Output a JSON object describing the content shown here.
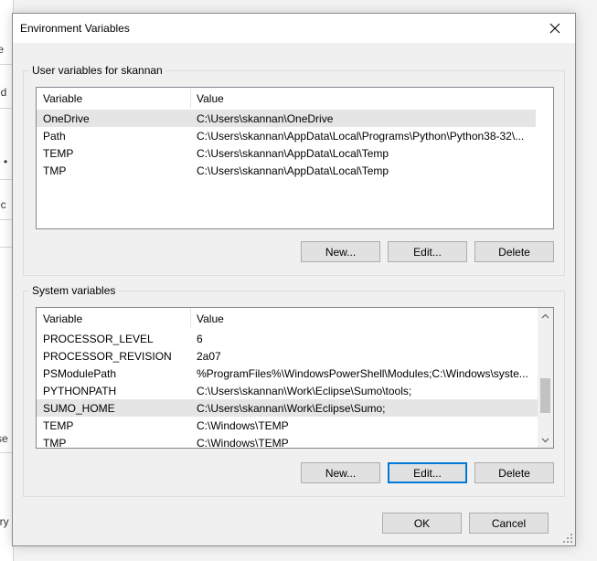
{
  "background_window": {
    "fragments": [
      "te",
      "ed",
      "•",
      "ec",
      "se",
      "ory"
    ]
  },
  "dialog": {
    "title": "Environment Variables",
    "close_icon": "close-icon"
  },
  "user_vars": {
    "group_label": "User variables for skannan",
    "columns": [
      "Variable",
      "Value"
    ],
    "rows": [
      {
        "name": "OneDrive",
        "value": "C:\\Users\\skannan\\OneDrive",
        "selected": true
      },
      {
        "name": "Path",
        "value": "C:\\Users\\skannan\\AppData\\Local\\Programs\\Python\\Python38-32\\...",
        "selected": false
      },
      {
        "name": "TEMP",
        "value": "C:\\Users\\skannan\\AppData\\Local\\Temp",
        "selected": false
      },
      {
        "name": "TMP",
        "value": "C:\\Users\\skannan\\AppData\\Local\\Temp",
        "selected": false
      }
    ],
    "buttons": {
      "new": "New...",
      "edit": "Edit...",
      "delete": "Delete"
    }
  },
  "system_vars": {
    "group_label": "System variables",
    "columns": [
      "Variable",
      "Value"
    ],
    "rows": [
      {
        "name": "PROCESSOR_LEVEL",
        "value": "6",
        "selected": false
      },
      {
        "name": "PROCESSOR_REVISION",
        "value": "2a07",
        "selected": false
      },
      {
        "name": "PSModulePath",
        "value": "%ProgramFiles%\\WindowsPowerShell\\Modules;C:\\Windows\\syste...",
        "selected": false
      },
      {
        "name": "PYTHONPATH",
        "value": "C:\\Users\\skannan\\Work\\Eclipse\\Sumo\\tools;",
        "selected": false
      },
      {
        "name": "SUMO_HOME",
        "value": "C:\\Users\\skannan\\Work\\Eclipse\\Sumo;",
        "selected": true
      },
      {
        "name": "TEMP",
        "value": "C:\\Windows\\TEMP",
        "selected": false
      },
      {
        "name": "TMP",
        "value": "C:\\Windows\\TEMP",
        "selected": false
      }
    ],
    "buttons": {
      "new": "New...",
      "edit": "Edit...",
      "delete": "Delete"
    }
  },
  "footer": {
    "ok": "OK",
    "cancel": "Cancel"
  },
  "colors": {
    "selected_row": "#e5e5e5",
    "focus_border": "#0078d7",
    "button_face": "#e1e1e1"
  }
}
